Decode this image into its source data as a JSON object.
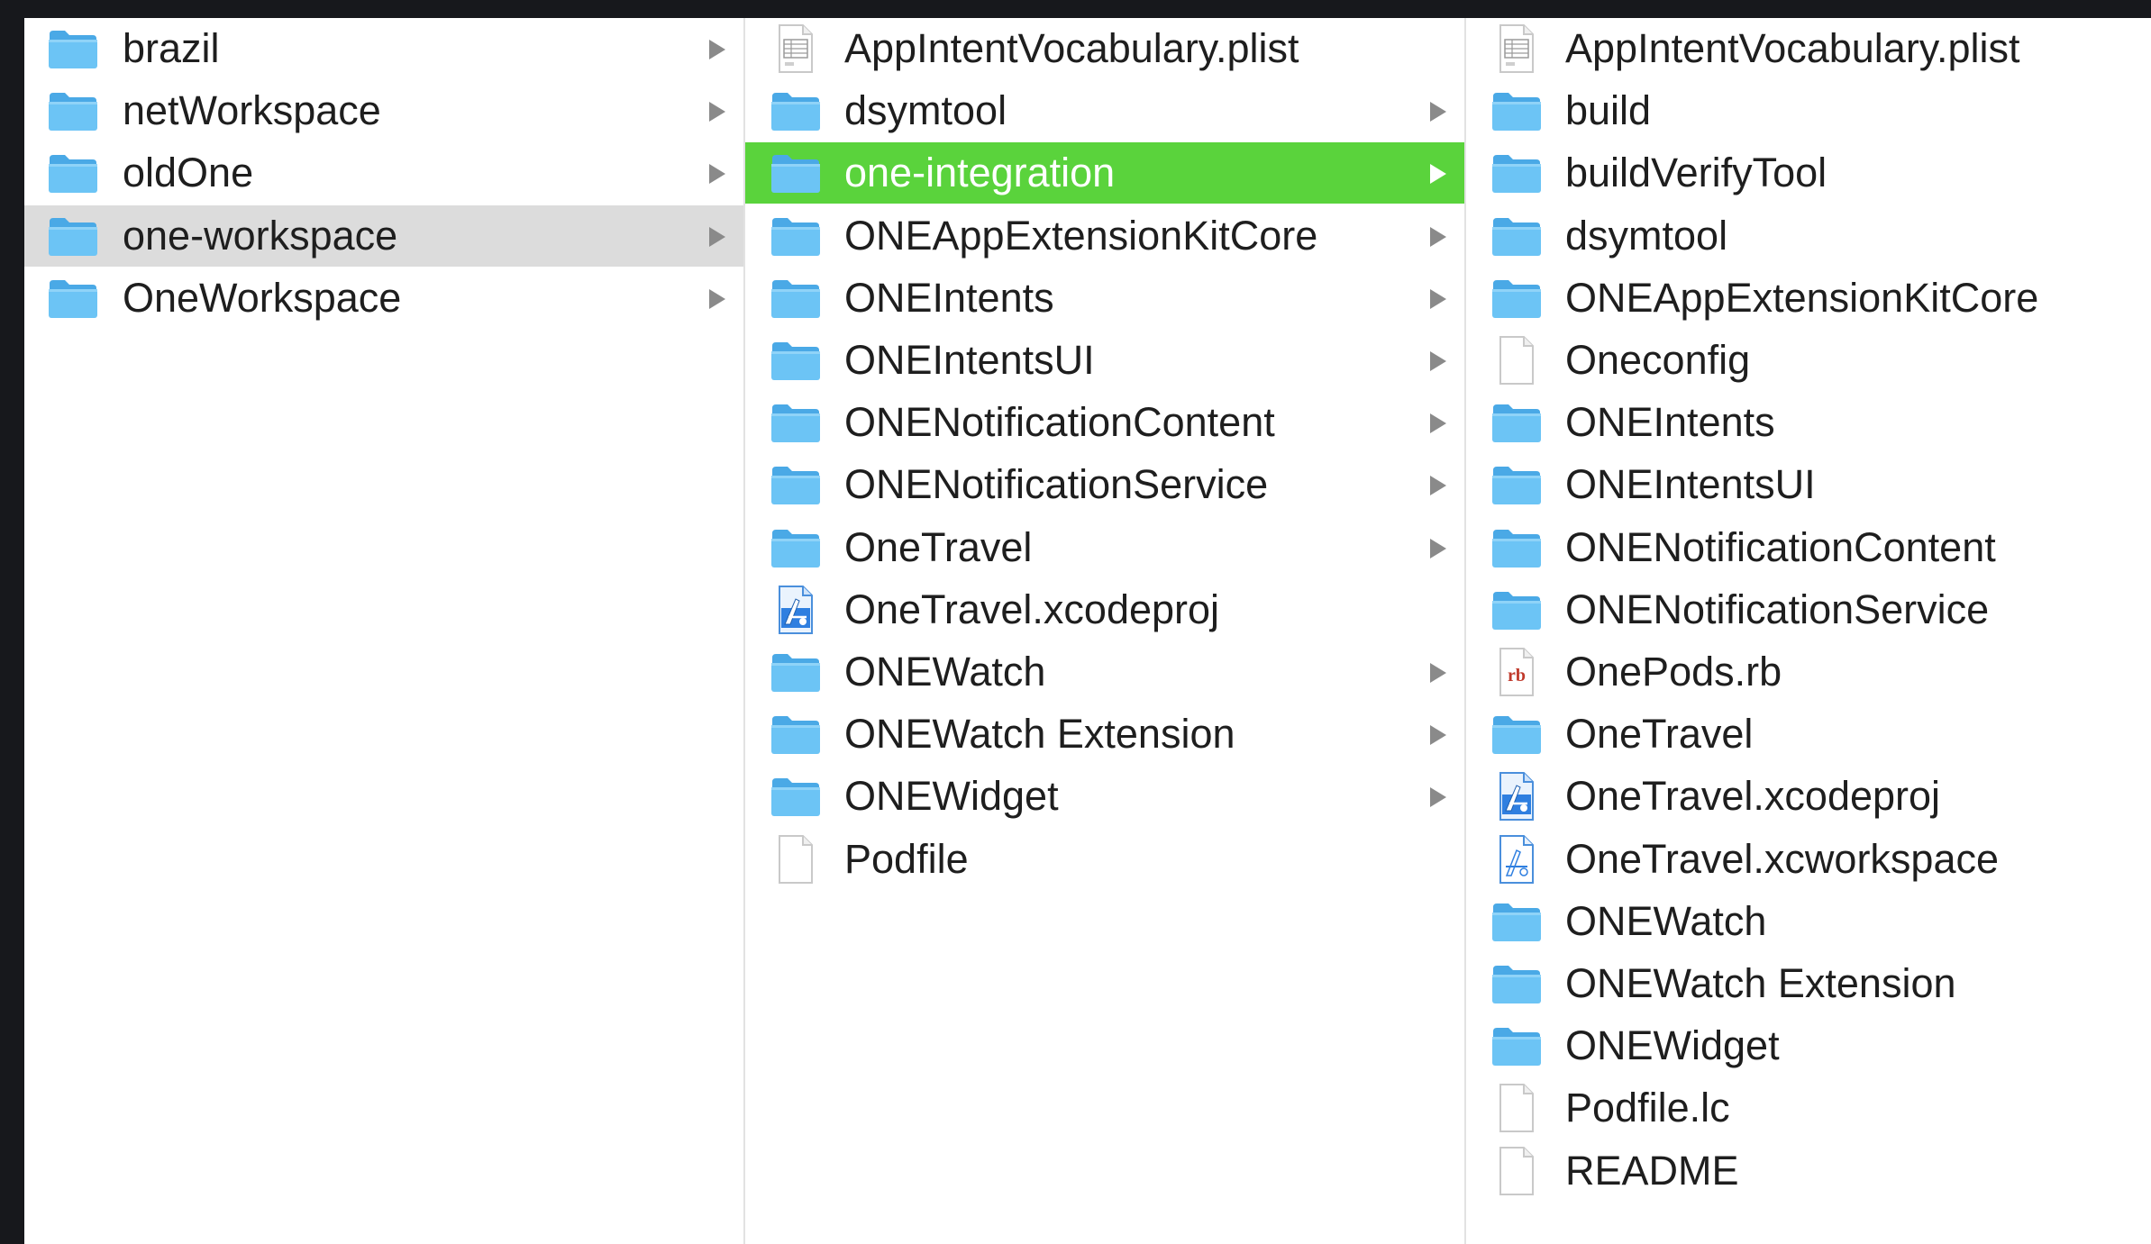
{
  "colors": {
    "folder_front": "#6cc4f5",
    "folder_back": "#4aa9e6",
    "selection_active": "#5ad33c",
    "selection_inactive": "#dcdcdc"
  },
  "columns": [
    {
      "items": [
        {
          "label": "brazil",
          "icon": "folder-icon",
          "arrow": true,
          "selected": false
        },
        {
          "label": "netWorkspace",
          "icon": "folder-icon",
          "arrow": true,
          "selected": false
        },
        {
          "label": "oldOne",
          "icon": "folder-icon",
          "arrow": true,
          "selected": false
        },
        {
          "label": "one-workspace",
          "icon": "folder-icon",
          "arrow": true,
          "selected": "inactive"
        },
        {
          "label": "OneWorkspace",
          "icon": "folder-icon",
          "arrow": true,
          "selected": false
        }
      ]
    },
    {
      "items": [
        {
          "label": "AppIntentVocabulary.plist",
          "icon": "plist-file-icon",
          "arrow": false,
          "selected": false
        },
        {
          "label": "dsymtool",
          "icon": "folder-icon",
          "arrow": true,
          "selected": false
        },
        {
          "label": "one-integration",
          "icon": "folder-icon",
          "arrow": true,
          "selected": "active"
        },
        {
          "label": "ONEAppExtensionKitCore",
          "icon": "folder-icon",
          "arrow": true,
          "selected": false
        },
        {
          "label": "ONEIntents",
          "icon": "folder-icon",
          "arrow": true,
          "selected": false
        },
        {
          "label": "ONEIntentsUI",
          "icon": "folder-icon",
          "arrow": true,
          "selected": false
        },
        {
          "label": "ONENotificationContent",
          "icon": "folder-icon",
          "arrow": true,
          "selected": false
        },
        {
          "label": "ONENotificationService",
          "icon": "folder-icon",
          "arrow": true,
          "selected": false
        },
        {
          "label": "OneTravel",
          "icon": "folder-icon",
          "arrow": true,
          "selected": false
        },
        {
          "label": "OneTravel.xcodeproj",
          "icon": "xcodeproj-icon",
          "arrow": false,
          "selected": false
        },
        {
          "label": "ONEWatch",
          "icon": "folder-icon",
          "arrow": true,
          "selected": false
        },
        {
          "label": "ONEWatch Extension",
          "icon": "folder-icon",
          "arrow": true,
          "selected": false
        },
        {
          "label": "ONEWidget",
          "icon": "folder-icon",
          "arrow": true,
          "selected": false
        },
        {
          "label": "Podfile",
          "icon": "blank-file-icon",
          "arrow": false,
          "selected": false
        }
      ]
    },
    {
      "items": [
        {
          "label": "AppIntentVocabulary.plist",
          "icon": "plist-file-icon",
          "arrow": false,
          "selected": false
        },
        {
          "label": "build",
          "icon": "folder-icon",
          "arrow": false,
          "selected": false
        },
        {
          "label": "buildVerifyTool",
          "icon": "folder-icon",
          "arrow": false,
          "selected": false
        },
        {
          "label": "dsymtool",
          "icon": "folder-icon",
          "arrow": false,
          "selected": false
        },
        {
          "label": "ONEAppExtensionKitCore",
          "icon": "folder-icon",
          "arrow": false,
          "selected": false
        },
        {
          "label": "Oneconfig",
          "icon": "blank-file-icon",
          "arrow": false,
          "selected": false
        },
        {
          "label": "ONEIntents",
          "icon": "folder-icon",
          "arrow": false,
          "selected": false
        },
        {
          "label": "ONEIntentsUI",
          "icon": "folder-icon",
          "arrow": false,
          "selected": false
        },
        {
          "label": "ONENotificationContent",
          "icon": "folder-icon",
          "arrow": false,
          "selected": false
        },
        {
          "label": "ONENotificationService",
          "icon": "folder-icon",
          "arrow": false,
          "selected": false
        },
        {
          "label": "OnePods.rb",
          "icon": "ruby-file-icon",
          "arrow": false,
          "selected": false,
          "icon_text": "rb"
        },
        {
          "label": "OneTravel",
          "icon": "folder-icon",
          "arrow": false,
          "selected": false
        },
        {
          "label": "OneTravel.xcodeproj",
          "icon": "xcodeproj-icon",
          "arrow": false,
          "selected": false
        },
        {
          "label": "OneTravel.xcworkspace",
          "icon": "xcworkspace-icon",
          "arrow": false,
          "selected": false
        },
        {
          "label": "ONEWatch",
          "icon": "folder-icon",
          "arrow": false,
          "selected": false
        },
        {
          "label": "ONEWatch Extension",
          "icon": "folder-icon",
          "arrow": false,
          "selected": false
        },
        {
          "label": "ONEWidget",
          "icon": "folder-icon",
          "arrow": false,
          "selected": false
        },
        {
          "label": "Podfile.lc",
          "icon": "blank-file-icon",
          "arrow": false,
          "selected": false
        },
        {
          "label": "README",
          "icon": "blank-file-icon",
          "arrow": false,
          "selected": false
        }
      ]
    }
  ]
}
